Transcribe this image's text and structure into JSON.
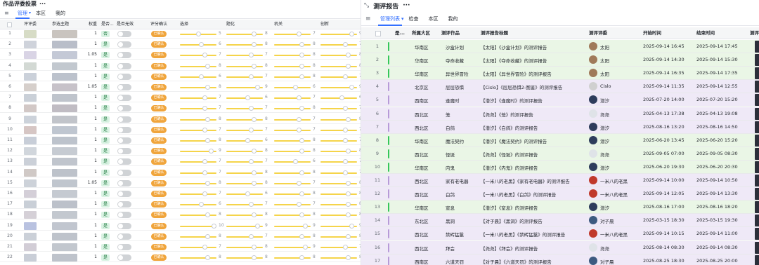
{
  "left": {
    "title": "作品评委投票",
    "tabs": [
      "管理",
      "本区",
      "我的"
    ],
    "headers": [
      "评评委",
      "参选主题",
      "权重",
      "是否...",
      "是否无效",
      "评分确认",
      "选择",
      "题化",
      "机关",
      "创新"
    ],
    "rows": [
      {
        "n": "1",
        "w": "1",
        "c1": "#d7dcc6",
        "c2": "#c9c4bf",
        "s": [
          5,
          8,
          7,
          9
        ]
      },
      {
        "n": "2",
        "w": "1",
        "c1": "#cfd3db",
        "c2": "#b9bec9",
        "s": [
          6,
          8,
          8,
          7
        ]
      },
      {
        "n": "3",
        "w": "1.05",
        "c1": "#d9d4e5",
        "c2": "#c4c9d6",
        "s": [
          7,
          7,
          8,
          8
        ]
      },
      {
        "n": "4",
        "w": "1",
        "c1": "#d3d9d4",
        "c2": "#c2c8cf",
        "s": [
          8,
          8,
          8,
          8
        ]
      },
      {
        "n": "5",
        "w": "1",
        "c1": "#cbd1da",
        "c2": "#bcc2cc",
        "s": [
          6,
          7,
          8,
          7
        ]
      },
      {
        "n": "6",
        "w": "1.05",
        "c1": "#d6cfcb",
        "c2": "#c7c2c9",
        "s": [
          8,
          9,
          6,
          9
        ]
      },
      {
        "n": "7",
        "w": "1",
        "c1": "#cad0d8",
        "c2": "#bfc4cc",
        "s": [
          7,
          6,
          7,
          6
        ]
      },
      {
        "n": "8",
        "w": "1",
        "c1": "#d2c8c6",
        "c2": "#c0bcc3",
        "s": [
          7,
          7,
          8,
          7
        ]
      },
      {
        "n": "9",
        "w": "1",
        "c1": "#ccd2da",
        "c2": "#c1c4ca",
        "s": [
          8,
          8,
          7,
          8
        ]
      },
      {
        "n": "10",
        "w": "1",
        "c1": "#d6c6c4",
        "c2": "#bfc6d0",
        "s": [
          7,
          7,
          7,
          7
        ]
      },
      {
        "n": "11",
        "w": "1",
        "c1": "#c8ced8",
        "c2": "#bdc3cc",
        "s": [
          8,
          6,
          8,
          7
        ]
      },
      {
        "n": "12",
        "w": "1",
        "c1": "#d1d6dc",
        "c2": "#c6cbd2",
        "s": [
          9,
          8,
          8,
          8
        ]
      },
      {
        "n": "13",
        "w": "1",
        "c1": "#cbd0d8",
        "c2": "#c0c5cd",
        "s": [
          7,
          7,
          6,
          7
        ]
      },
      {
        "n": "14",
        "w": "1",
        "c1": "#d0c9c6",
        "c2": "#bdc2ca",
        "s": [
          7,
          8,
          8,
          7
        ]
      },
      {
        "n": "15",
        "w": "1.05",
        "c1": "#cdd2d9",
        "c2": "#c0c6ce",
        "s": [
          8,
          8,
          7,
          8
        ]
      },
      {
        "n": "16",
        "w": "1",
        "c1": "#d4cfd8",
        "c2": "#c5cad1",
        "s": [
          7,
          6,
          8,
          8
        ]
      },
      {
        "n": "17",
        "w": "1",
        "c1": "#c9cfd7",
        "c2": "#bcc1ca",
        "s": [
          6,
          7,
          7,
          8
        ]
      },
      {
        "n": "18",
        "w": "1",
        "c1": "#d5d0d7",
        "c2": "#c3c8cf",
        "s": [
          8,
          8,
          8,
          8
        ]
      },
      {
        "n": "19",
        "w": "1",
        "c1": "#b9c2e0",
        "c2": "#c1c6cf",
        "s": [
          10,
          9,
          9,
          9
        ]
      },
      {
        "n": "20",
        "w": "1",
        "c1": "#cbd0d8",
        "c2": "#bec3cb",
        "s": [
          8,
          7,
          8,
          8
        ]
      },
      {
        "n": "21",
        "w": "1",
        "c1": "#d2cdd6",
        "c2": "#c2c7ce",
        "s": [
          7,
          8,
          9,
          7
        ]
      },
      {
        "n": "22",
        "w": "1",
        "c1": "#c9ced7",
        "c2": "#bec3cb",
        "s": [
          8,
          8,
          8,
          8
        ]
      }
    ],
    "yes_label": "是",
    "yes_label_alt": "否",
    "confirm_label": "已确认"
  },
  "right": {
    "title": "测评报告",
    "tabs": [
      "管理列表",
      "检查",
      "本区",
      "我的"
    ],
    "headers": [
      "是...",
      "所属大区",
      "测评作品",
      "测评报告标题",
      "测评评委",
      "开始时间",
      "结束时间",
      "测评"
    ],
    "rows": [
      {
        "n": "1",
        "bg": "green",
        "bar": "#34c759",
        "region": "华南区",
        "work": "沙盒计划",
        "title": "【太阳】《沙盒计划》的测评报告",
        "judge": "太阳",
        "start": "2025-09-14 16:45",
        "end": "2025-09-14 17:45",
        "ava": "#a07a5a"
      },
      {
        "n": "2",
        "bg": "green",
        "bar": "#34c759",
        "region": "华南区",
        "work": "夺命收藏",
        "title": "【太阳】《夺命收藏》的测评报告",
        "judge": "太阳",
        "start": "2025-09-14 14:30",
        "end": "2025-09-14 15:30",
        "ava": "#a07a5a"
      },
      {
        "n": "3",
        "bg": "green",
        "bar": "#34c759",
        "region": "华南区",
        "work": "异世界冒险",
        "title": "【太阳】《异世界冒险》的测评报告",
        "judge": "太阳",
        "start": "2025-09-14 16:35",
        "end": "2025-09-14 17:35",
        "ava": "#a07a5a"
      },
      {
        "n": "4",
        "bg": "purple",
        "bar": "#b79ad8",
        "region": "北京区",
        "work": "层层恐惧",
        "title": "【Cislo】《层层恐惧2-图鉴》的测评报告",
        "judge": "Cislo",
        "start": "2025-09-14 11:35",
        "end": "2025-09-14 12:55",
        "ava": "#d0d0d0"
      },
      {
        "n": "5",
        "bg": "purple",
        "bar": "#b79ad8",
        "region": "西南区",
        "work": "逢魔时",
        "title": "【潜汐】《逢魔时》的测评报告",
        "judge": "潜汐",
        "start": "2025-07-20 14:00",
        "end": "2025-07-20 15:20",
        "ava": "#2e3d5c"
      },
      {
        "n": "6",
        "bg": "purple",
        "bar": "#b79ad8",
        "region": "西北区",
        "work": "笼",
        "title": "【尧尧】《笼》的测评报告",
        "judge": "尧尧",
        "start": "2025-04-13 17:38",
        "end": "2025-04-13 19:08",
        "ava": "#dfe3e8"
      },
      {
        "n": "7",
        "bg": "purple",
        "bar": "#b79ad8",
        "region": "西北区",
        "work": "白鸽",
        "title": "【潜汐】《白鸽》的测评报告",
        "judge": "潜汐",
        "start": "2025-08-16 13:20",
        "end": "2025-08-16 14:50",
        "ava": "#2e3d5c"
      },
      {
        "n": "8",
        "bg": "green",
        "bar": "#34c759",
        "region": "华南区",
        "work": "魔法契约",
        "title": "【潜汐】《魔法契约》的测评报告",
        "judge": "潜汐",
        "start": "2025-06-20 13:45",
        "end": "2025-06-20 15:20",
        "ava": "#2e3d5c"
      },
      {
        "n": "9",
        "bg": "green",
        "bar": "#34c759",
        "region": "西北区",
        "work": "怪诞",
        "title": "【尧尧】《怪诞》的测评报告",
        "judge": "尧尧",
        "start": "2025-09-05 07:00",
        "end": "2025-09-05 08:30",
        "ava": "#dfe3e8"
      },
      {
        "n": "10",
        "bg": "green",
        "bar": "#34c759",
        "region": "华南区",
        "work": "内鬼",
        "title": "【潜汐】《内鬼》的测评报告",
        "judge": "潜汐",
        "start": "2025-06-20 19:30",
        "end": "2025-06-20 20:30",
        "ava": "#2e3d5c"
      },
      {
        "n": "11",
        "bg": "purple",
        "bar": "#b79ad8",
        "region": "西北区",
        "work": "家有老电器",
        "title": "【一米八的老黑】《家有老电器》的测评报告",
        "judge": "一米八的老黑",
        "start": "2025-09-14 10:00",
        "end": "2025-09-14 10:50",
        "ava": "#c0392b"
      },
      {
        "n": "12",
        "bg": "purple",
        "bar": "#b79ad8",
        "region": "西北区",
        "work": "白鸽",
        "title": "【一米八的老黑】《白鸽》的测评报告",
        "judge": "一米八的老黑",
        "start": "2025-09-14 12:05",
        "end": "2025-09-14 13:30",
        "ava": "#c0392b"
      },
      {
        "n": "13",
        "bg": "green",
        "bar": "#34c759",
        "region": "华南区",
        "work": "窒息",
        "title": "【潜汐】《窒息》的测评报告",
        "judge": "潜汐",
        "start": "2025-08-16 17:00",
        "end": "2025-08-16 18:20",
        "ava": "#2e3d5c"
      },
      {
        "n": "14",
        "bg": "purple",
        "bar": "#b79ad8",
        "region": "东北区",
        "work": "黑洞",
        "title": "【对子晨】《黑洞》的测评报告",
        "judge": "对子晨",
        "start": "2025-03-15 18:30",
        "end": "2025-03-15 19:30",
        "ava": "#3d5a80"
      },
      {
        "n": "15",
        "bg": "purple",
        "bar": "#b79ad8",
        "region": "西北区",
        "work": "禁砖猛鬣",
        "title": "【一米八的老黑】《禁砖猛鬣》的测评报告",
        "judge": "一米八的老黑",
        "start": "2025-09-14 10:15",
        "end": "2025-09-14 11:00",
        "ava": "#c0392b"
      },
      {
        "n": "16",
        "bg": "purple",
        "bar": "#b79ad8",
        "region": "西北区",
        "work": "拜会",
        "title": "【尧尧】《拜会》的测评报告",
        "judge": "尧尧",
        "start": "2025-08-14 08:30",
        "end": "2025-09-14 08:30",
        "ava": "#dfe3e8"
      },
      {
        "n": "17",
        "bg": "purple",
        "bar": "#b79ad8",
        "region": "西南区",
        "work": "六道天罚",
        "title": "【对子晨】《六道天罚》的测评报告",
        "judge": "对子晨",
        "start": "2025-08-25 18:30",
        "end": "2025-08-25 20:00",
        "ava": "#3d5a80"
      }
    ]
  }
}
